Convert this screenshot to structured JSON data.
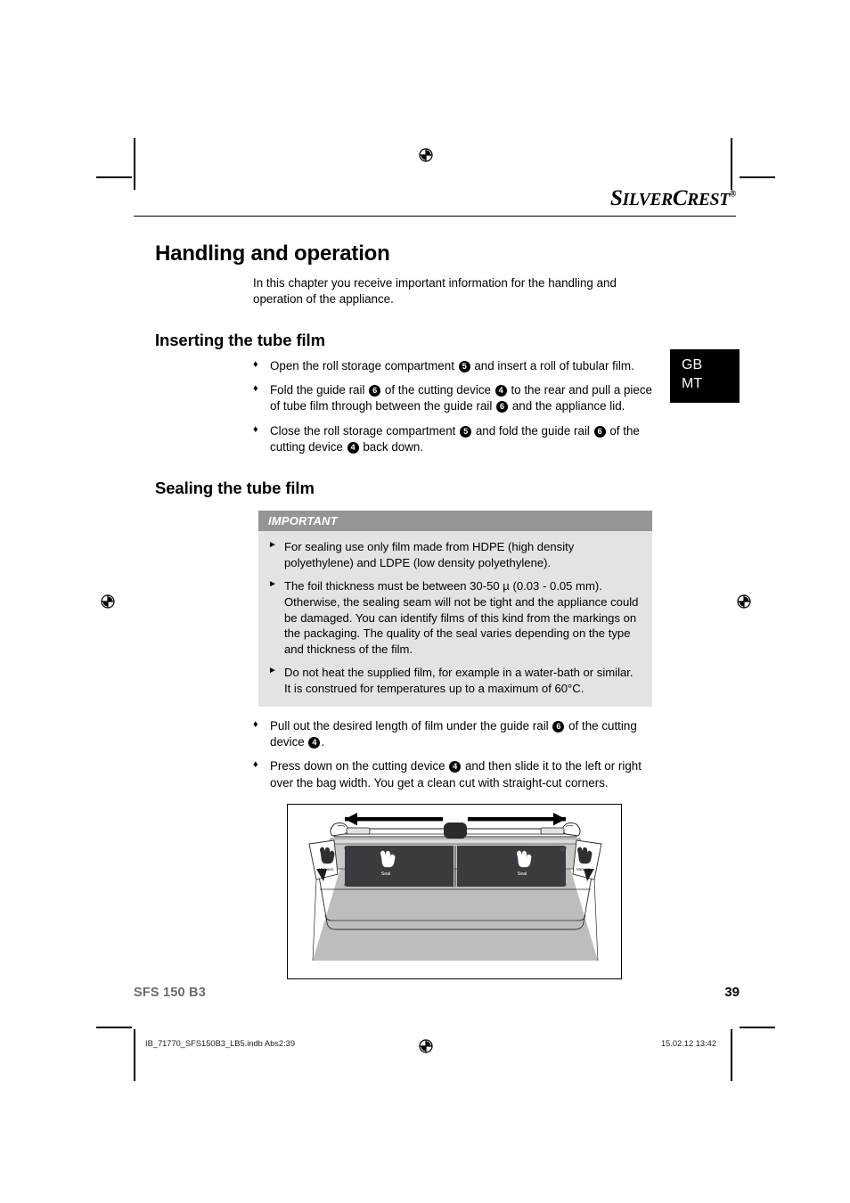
{
  "brand": {
    "part1": "S",
    "part2": "ILVER",
    "part3": "C",
    "part4": "REST",
    "registered": "®"
  },
  "language_tab": {
    "line1": "GB",
    "line2": "MT"
  },
  "main_heading": "Handling and operation",
  "intro": "In this chapter you receive important information for the handling and operation of the appliance.",
  "section_inserting": {
    "heading": "Inserting the tube film",
    "bullet_glyph": "♦",
    "items": [
      {
        "parts": [
          {
            "t": "text",
            "v": "Open the roll storage compartment "
          },
          {
            "t": "ref",
            "v": "5"
          },
          {
            "t": "text",
            "v": " and insert a roll of tubular film."
          }
        ]
      },
      {
        "parts": [
          {
            "t": "text",
            "v": "Fold the guide rail "
          },
          {
            "t": "ref",
            "v": "6"
          },
          {
            "t": "text",
            "v": " of the cutting device "
          },
          {
            "t": "ref",
            "v": "4"
          },
          {
            "t": "text",
            "v": " to the rear and pull a piece of tube film through between the guide rail "
          },
          {
            "t": "ref",
            "v": "6"
          },
          {
            "t": "text",
            "v": " and the appliance lid."
          }
        ]
      },
      {
        "parts": [
          {
            "t": "text",
            "v": "Close the roll storage compartment "
          },
          {
            "t": "ref",
            "v": "5"
          },
          {
            "t": "text",
            "v": " and fold the guide rail "
          },
          {
            "t": "ref",
            "v": "6"
          },
          {
            "t": "text",
            "v": " of the cutting device "
          },
          {
            "t": "ref",
            "v": "4"
          },
          {
            "t": "text",
            "v": " back down."
          }
        ]
      }
    ]
  },
  "section_sealing": {
    "heading": "Sealing the tube film",
    "bullet_glyph": "♦",
    "important": {
      "title": "IMPORTANT",
      "arrow_glyph": "►",
      "items": [
        "For sealing use only film made from HDPE (high density polyethylene) and LDPE (low density polyethylene).",
        "The foil thickness must be between 30-50 µ (0.03 - 0.05 mm). Otherwise, the sealing seam will not be tight and the appliance could be damaged. You can identify films of this kind from the markings on the packaging. The quality of the seal varies depending on the type and thickness of the film.",
        "Do not heat the supplied film, for example in a water-bath or similar. It is construed for temperatures up to a maximum of 60°C."
      ]
    },
    "items": [
      {
        "parts": [
          {
            "t": "text",
            "v": "Pull out the desired length of film under the guide rail "
          },
          {
            "t": "ref",
            "v": "6"
          },
          {
            "t": "text",
            "v": " of the cutting device "
          },
          {
            "t": "ref",
            "v": "4"
          },
          {
            "t": "text",
            "v": "."
          }
        ]
      },
      {
        "parts": [
          {
            "t": "text",
            "v": "Press down on the cutting device "
          },
          {
            "t": "ref",
            "v": "4"
          },
          {
            "t": "text",
            "v": " and then slide it to the left or right over the bag width. You get a clean cut with straight-cut corners."
          }
        ]
      }
    ]
  },
  "figure": {
    "alt": "Vacuum sealer appliance seen from front with tube film pulled out and cutting-device travel arrows",
    "button_left_label": "Seal",
    "button_right_label": "Seal",
    "vacuum_left_label": "Vacuum",
    "vacuum_right_label": "Vacuum",
    "brand_label": "SilverCrest"
  },
  "footer": {
    "model": "SFS 150 B3",
    "page_number": "39",
    "print_file": "IB_71770_SFS150B3_LB5.indb   Abs2:39",
    "print_timestamp": "15.02.12   13:42"
  },
  "colors": {
    "important_header_bg": "#959595",
    "important_body_bg": "#e3e3e3",
    "lang_tab_bg": "#000000",
    "model_text": "#6b6b6b",
    "film_gray": "#bdbdbd",
    "panel_dark": "#3a3a3f"
  }
}
